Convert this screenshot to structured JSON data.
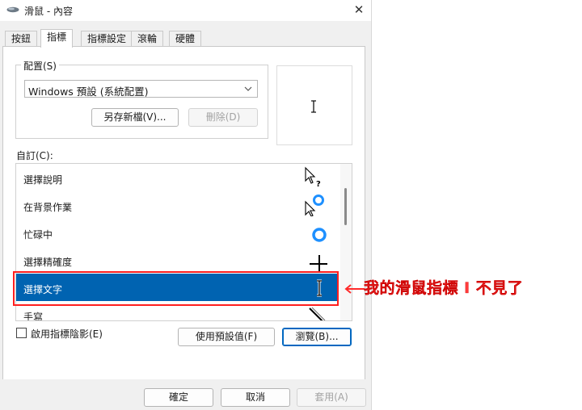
{
  "window": {
    "title": "滑鼠 - 內容",
    "close_glyph": "✕"
  },
  "tabs": [
    {
      "label": "按鈕",
      "active": false
    },
    {
      "label": "指標",
      "active": true
    },
    {
      "label": "指標設定",
      "active": false
    },
    {
      "label": "滾輪",
      "active": false
    },
    {
      "label": "硬體",
      "active": false
    }
  ],
  "scheme": {
    "label": "配置(S)",
    "selected": "Windows 預設 (系統配置)",
    "save_as_label": "另存新檔(V)...",
    "delete_label": "刪除(D)"
  },
  "customize": {
    "label": "自訂(C):",
    "rows": [
      {
        "label": "選擇說明",
        "icon": "help-select-cursor-icon"
      },
      {
        "label": "在背景作業",
        "icon": "working-in-background-cursor-icon"
      },
      {
        "label": "忙碌中",
        "icon": "busy-cursor-icon"
      },
      {
        "label": "選擇精確度",
        "icon": "precision-select-cursor-icon"
      },
      {
        "label": "選擇文字",
        "icon": "text-select-cursor-icon",
        "selected": true
      },
      {
        "label": "手寫",
        "icon": "handwriting-cursor-icon"
      }
    ]
  },
  "shadow": {
    "label": "啟用指標陰影(E)",
    "checked": false
  },
  "buttons": {
    "use_default": "使用預設值(F)",
    "browse": "瀏覽(B)..."
  },
  "footer": {
    "ok": "確定",
    "cancel": "取消",
    "apply": "套用(A)"
  },
  "annotation": {
    "text": "我的滑鼠指標 I 不見了",
    "color": "#ff3b3b"
  },
  "colors": {
    "selection": "#0063b1",
    "highlight_border": "#ff1f1f",
    "accent": "#0067c0"
  }
}
